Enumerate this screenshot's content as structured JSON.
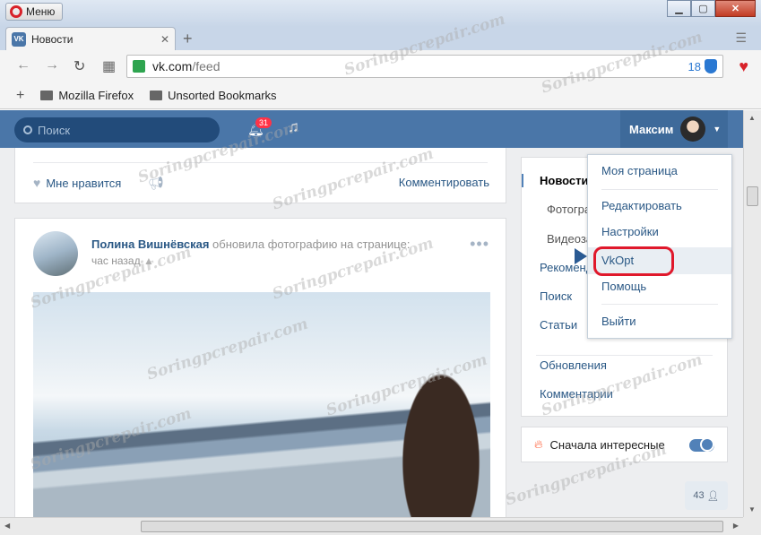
{
  "browser": {
    "menu_label": "Меню",
    "tab_title": "Новости",
    "tab_icon": "VK",
    "url_host": "vk.com",
    "url_path": "/feed",
    "blocked_count": "18",
    "bookmarks": [
      "Mozilla Firefox",
      "Unsorted Bookmarks"
    ]
  },
  "vk_header": {
    "search_placeholder": "Поиск",
    "notifications_badge": "31",
    "profile_name": "Максим"
  },
  "feed": {
    "like_label": "Мне нравится",
    "comment_label": "Комментировать",
    "post": {
      "author": "Полина Вишнёвская",
      "action": "обновила фотографию на странице:",
      "time": "час назад"
    }
  },
  "right_nav": {
    "items": [
      "Новости",
      "Фотографии",
      "Видеозаписи",
      "Рекомендации",
      "Поиск",
      "Статьи",
      "Обновления",
      "Комментарии"
    ],
    "interest_label": "Сначала интересные",
    "online_count": "43"
  },
  "dropdown": {
    "items": [
      "Моя страница",
      "Редактировать",
      "Настройки",
      "VkOpt",
      "Помощь",
      "Выйти"
    ],
    "highlighted": "VkOpt"
  },
  "watermark": "Soringpcrepair.com",
  "colors": {
    "vk_blue": "#4a76a8",
    "link": "#2a5885",
    "highlight_oval": "#e0182b"
  }
}
